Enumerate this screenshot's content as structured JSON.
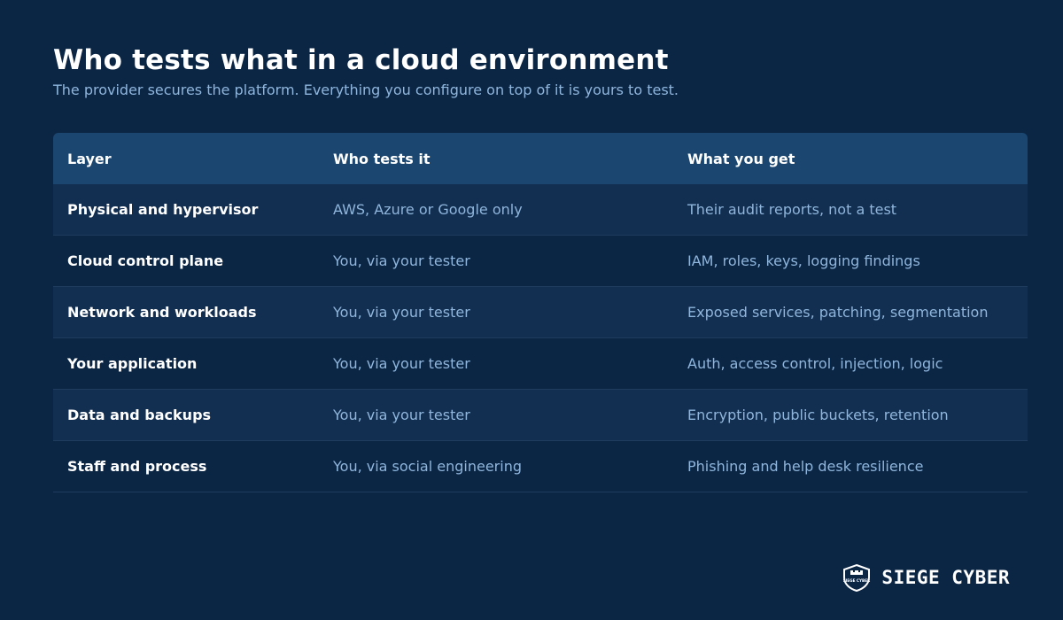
{
  "title": "Who tests what in a cloud environment",
  "subtitle": "The provider secures the platform. Everything you configure on top of it is yours to test.",
  "table": {
    "headers": [
      "Layer",
      "Who tests it",
      "What you get"
    ],
    "rows": [
      [
        "Physical and hypervisor",
        "AWS, Azure or Google only",
        "Their audit reports, not a test"
      ],
      [
        "Cloud control plane",
        "You, via your tester",
        "IAM, roles, keys, logging findings"
      ],
      [
        "Network and workloads",
        "You, via your tester",
        "Exposed services, patching, segmentation"
      ],
      [
        "Your application",
        "You, via your tester",
        "Auth, access control, injection, logic"
      ],
      [
        "Data and backups",
        "You, via your tester",
        "Encryption, public buckets, retention"
      ],
      [
        "Staff and process",
        "You, via social engineering",
        "Phishing and help desk resilience"
      ]
    ]
  },
  "brand": {
    "name": "SIEGE CYBER",
    "logo_text": "SIEGE CYBER",
    "logo_icon": "shield-logo-icon"
  },
  "colors": {
    "background": "#0b2545",
    "header_row": "#1a4670",
    "alt_row": "#122e50",
    "text_primary": "#ffffff",
    "text_secondary": "#8fb6dc"
  }
}
